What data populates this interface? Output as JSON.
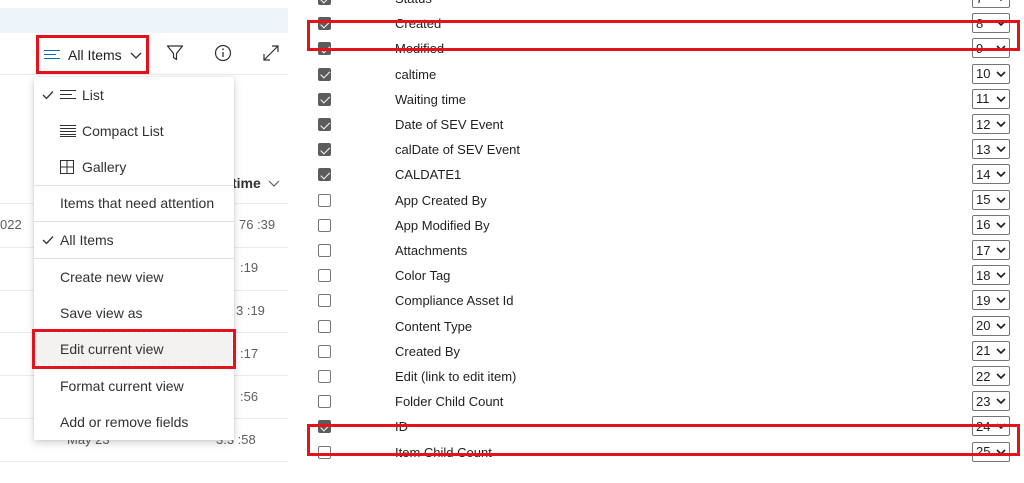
{
  "toolbar": {
    "view_label": "All Items"
  },
  "view_menu": {
    "items": [
      {
        "label": "List",
        "checked": true,
        "icon": "list-icon"
      },
      {
        "label": "Compact List",
        "checked": false,
        "icon": "compact-list-icon"
      },
      {
        "label": "Gallery",
        "checked": false,
        "icon": "gallery-icon"
      },
      {
        "label": "Items that need attention",
        "checked": false
      },
      {
        "label": "All Items",
        "checked": true
      },
      {
        "label": "Create new view",
        "checked": false
      },
      {
        "label": "Save view as",
        "checked": false
      },
      {
        "label": "Edit current view",
        "checked": false,
        "highlighted": true
      },
      {
        "label": "Format current view",
        "checked": false
      },
      {
        "label": "Add or remove fields",
        "checked": false
      }
    ]
  },
  "list_background": {
    "column_header": "time",
    "cells": [
      "022",
      "76 :39",
      ":19",
      "3 :19",
      ":17",
      ":56",
      "May 23",
      "3:3 :58"
    ]
  },
  "fields": [
    {
      "name": "Status",
      "checked": true,
      "position": "7"
    },
    {
      "name": "Created",
      "checked": true,
      "position": "8",
      "highlighted": true
    },
    {
      "name": "Modified",
      "checked": true,
      "position": "9"
    },
    {
      "name": "caltime",
      "checked": true,
      "position": "10"
    },
    {
      "name": "Waiting time",
      "checked": true,
      "position": "11"
    },
    {
      "name": "Date of SEV Event",
      "checked": true,
      "position": "12"
    },
    {
      "name": "calDate of SEV Event",
      "checked": true,
      "position": "13"
    },
    {
      "name": "CALDATE1",
      "checked": true,
      "position": "14"
    },
    {
      "name": "App Created By",
      "checked": false,
      "position": "15"
    },
    {
      "name": "App Modified By",
      "checked": false,
      "position": "16"
    },
    {
      "name": "Attachments",
      "checked": false,
      "position": "17"
    },
    {
      "name": "Color Tag",
      "checked": false,
      "position": "18"
    },
    {
      "name": "Compliance Asset Id",
      "checked": false,
      "position": "19"
    },
    {
      "name": "Content Type",
      "checked": false,
      "position": "20"
    },
    {
      "name": "Created By",
      "checked": false,
      "position": "21"
    },
    {
      "name": "Edit (link to edit item)",
      "checked": false,
      "position": "22"
    },
    {
      "name": "Folder Child Count",
      "checked": false,
      "position": "23"
    },
    {
      "name": "ID",
      "checked": true,
      "position": "24",
      "highlighted": true
    },
    {
      "name": "Item Child Count",
      "checked": false,
      "position": "25"
    }
  ],
  "colors": {
    "highlight": "#e3121c",
    "accent": "#0f6cbd",
    "checkbox_checked": "#5c5c5c"
  }
}
